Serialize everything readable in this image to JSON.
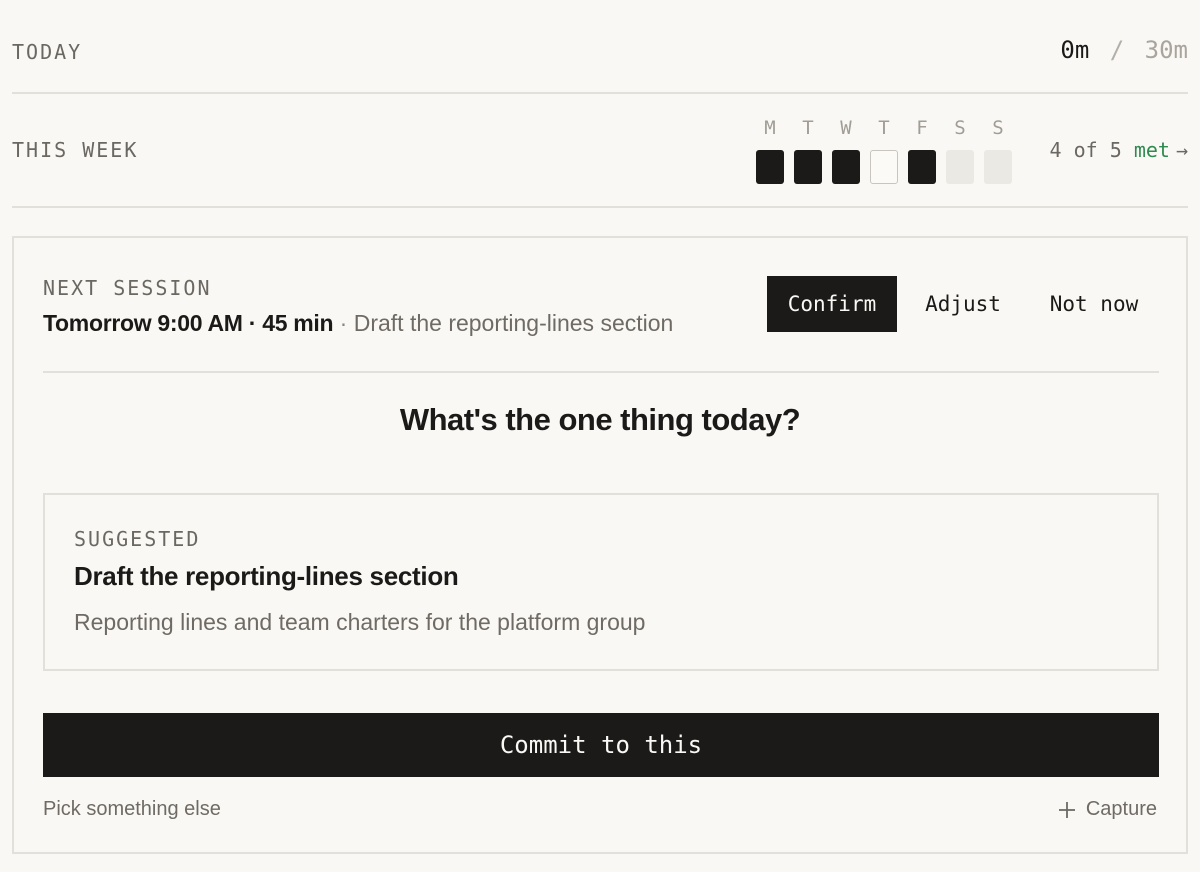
{
  "today": {
    "label": "TODAY",
    "current": "0m",
    "separator": "/",
    "goal": "30m"
  },
  "week": {
    "label": "THIS WEEK",
    "days": [
      {
        "letter": "M",
        "status": "met"
      },
      {
        "letter": "T",
        "status": "met"
      },
      {
        "letter": "W",
        "status": "met"
      },
      {
        "letter": "T",
        "status": "missed"
      },
      {
        "letter": "F",
        "status": "met"
      },
      {
        "letter": "S",
        "status": "future"
      },
      {
        "letter": "S",
        "status": "future"
      }
    ],
    "summary_prefix": "4 of 5 ",
    "summary_met": "met",
    "summary_arrow": "→"
  },
  "next_session": {
    "label": "NEXT SESSION",
    "when": "Tomorrow 9:00 AM · 45 min",
    "separator": " · ",
    "task": "Draft the reporting-lines section",
    "buttons": {
      "confirm": "Confirm",
      "adjust": "Adjust",
      "not_now": "Not now"
    }
  },
  "question": "What's the one thing today?",
  "suggested": {
    "label": "SUGGESTED",
    "title": "Draft the reporting-lines section",
    "description": "Reporting lines and team charters for the platform group"
  },
  "actions": {
    "commit": "Commit to this",
    "pick_else": "Pick something else",
    "capture": "Capture",
    "capture_icon": "plus-icon"
  },
  "colors": {
    "background": "#f9f8f5",
    "ink": "#1b1a18",
    "muted": "#6b6862",
    "accent_green": "#2e8b4f",
    "border": "#e2e0da"
  }
}
